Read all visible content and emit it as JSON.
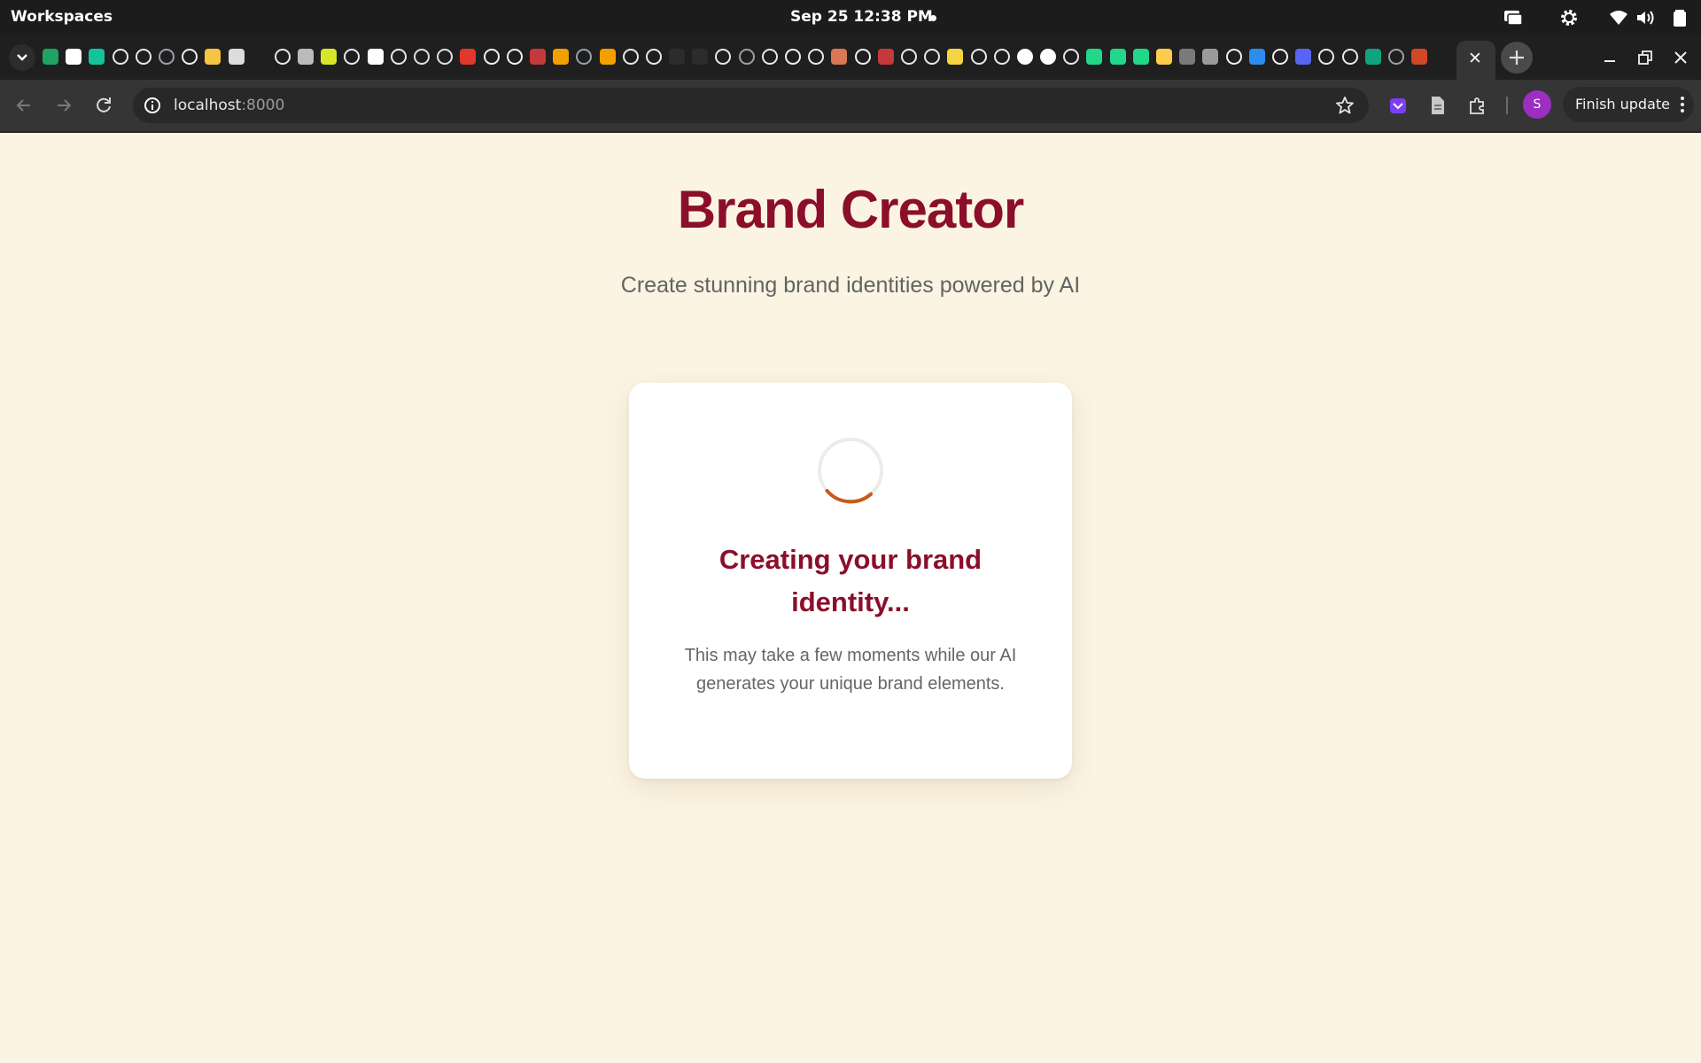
{
  "os": {
    "workspaces_label": "Workspaces",
    "clock": "Sep 25  12:38 PM"
  },
  "browser": {
    "url_host": "localhost",
    "url_port": ":8000",
    "profile_initial": "S",
    "finish_update_label": "Finish update"
  },
  "page": {
    "title": "Brand Creator",
    "subtitle": "Create stunning brand identities powered by AI",
    "loading": {
      "heading": "Creating your brand identity...",
      "message": "This may take a few moments while our AI generates your unique brand elements."
    }
  },
  "colors": {
    "brand_primary": "#8b0e2a",
    "spinner_accent": "#c85a1a",
    "page_background": "#fbf4e2",
    "profile_avatar": "#9b2fc0"
  },
  "icons": {
    "tab_favicons": [
      "sheets-icon",
      "font-icon",
      "grammar-icon",
      "openai-icon",
      "openai-icon",
      "globe-icon",
      "github-icon",
      "emoji-icon",
      "news-icon",
      "doc-icon",
      "openai-icon",
      "sparkle-icon",
      "badge-icon",
      "openai-icon",
      "pill-icon",
      "openai-icon",
      "slack-icon",
      "slack-icon",
      "k-icon",
      "github-icon",
      "github-icon",
      "x-icon",
      "meta-icon",
      "globe-icon",
      "meta-icon",
      "openai-icon",
      "openai-icon",
      "dark-icon",
      "dark-icon",
      "openai-icon",
      "globe-icon",
      "openai-icon",
      "github-icon",
      "openai-icon",
      "claude-icon",
      "github-icon",
      "x-icon",
      "openai-icon",
      "openai-icon",
      "smiley-icon",
      "openai-icon",
      "openai-icon",
      "notion-icon",
      "notion-icon",
      "openai-icon",
      "pycharm-icon",
      "pycharm-icon",
      "pycharm-icon",
      "huggingface-icon",
      "grey-icon",
      "link-icon",
      "github-icon",
      "c-icon",
      "github-icon",
      "discord-icon",
      "openai-icon",
      "openai-icon",
      "feather-icon",
      "globe-icon",
      "powerpoint-icon"
    ]
  }
}
